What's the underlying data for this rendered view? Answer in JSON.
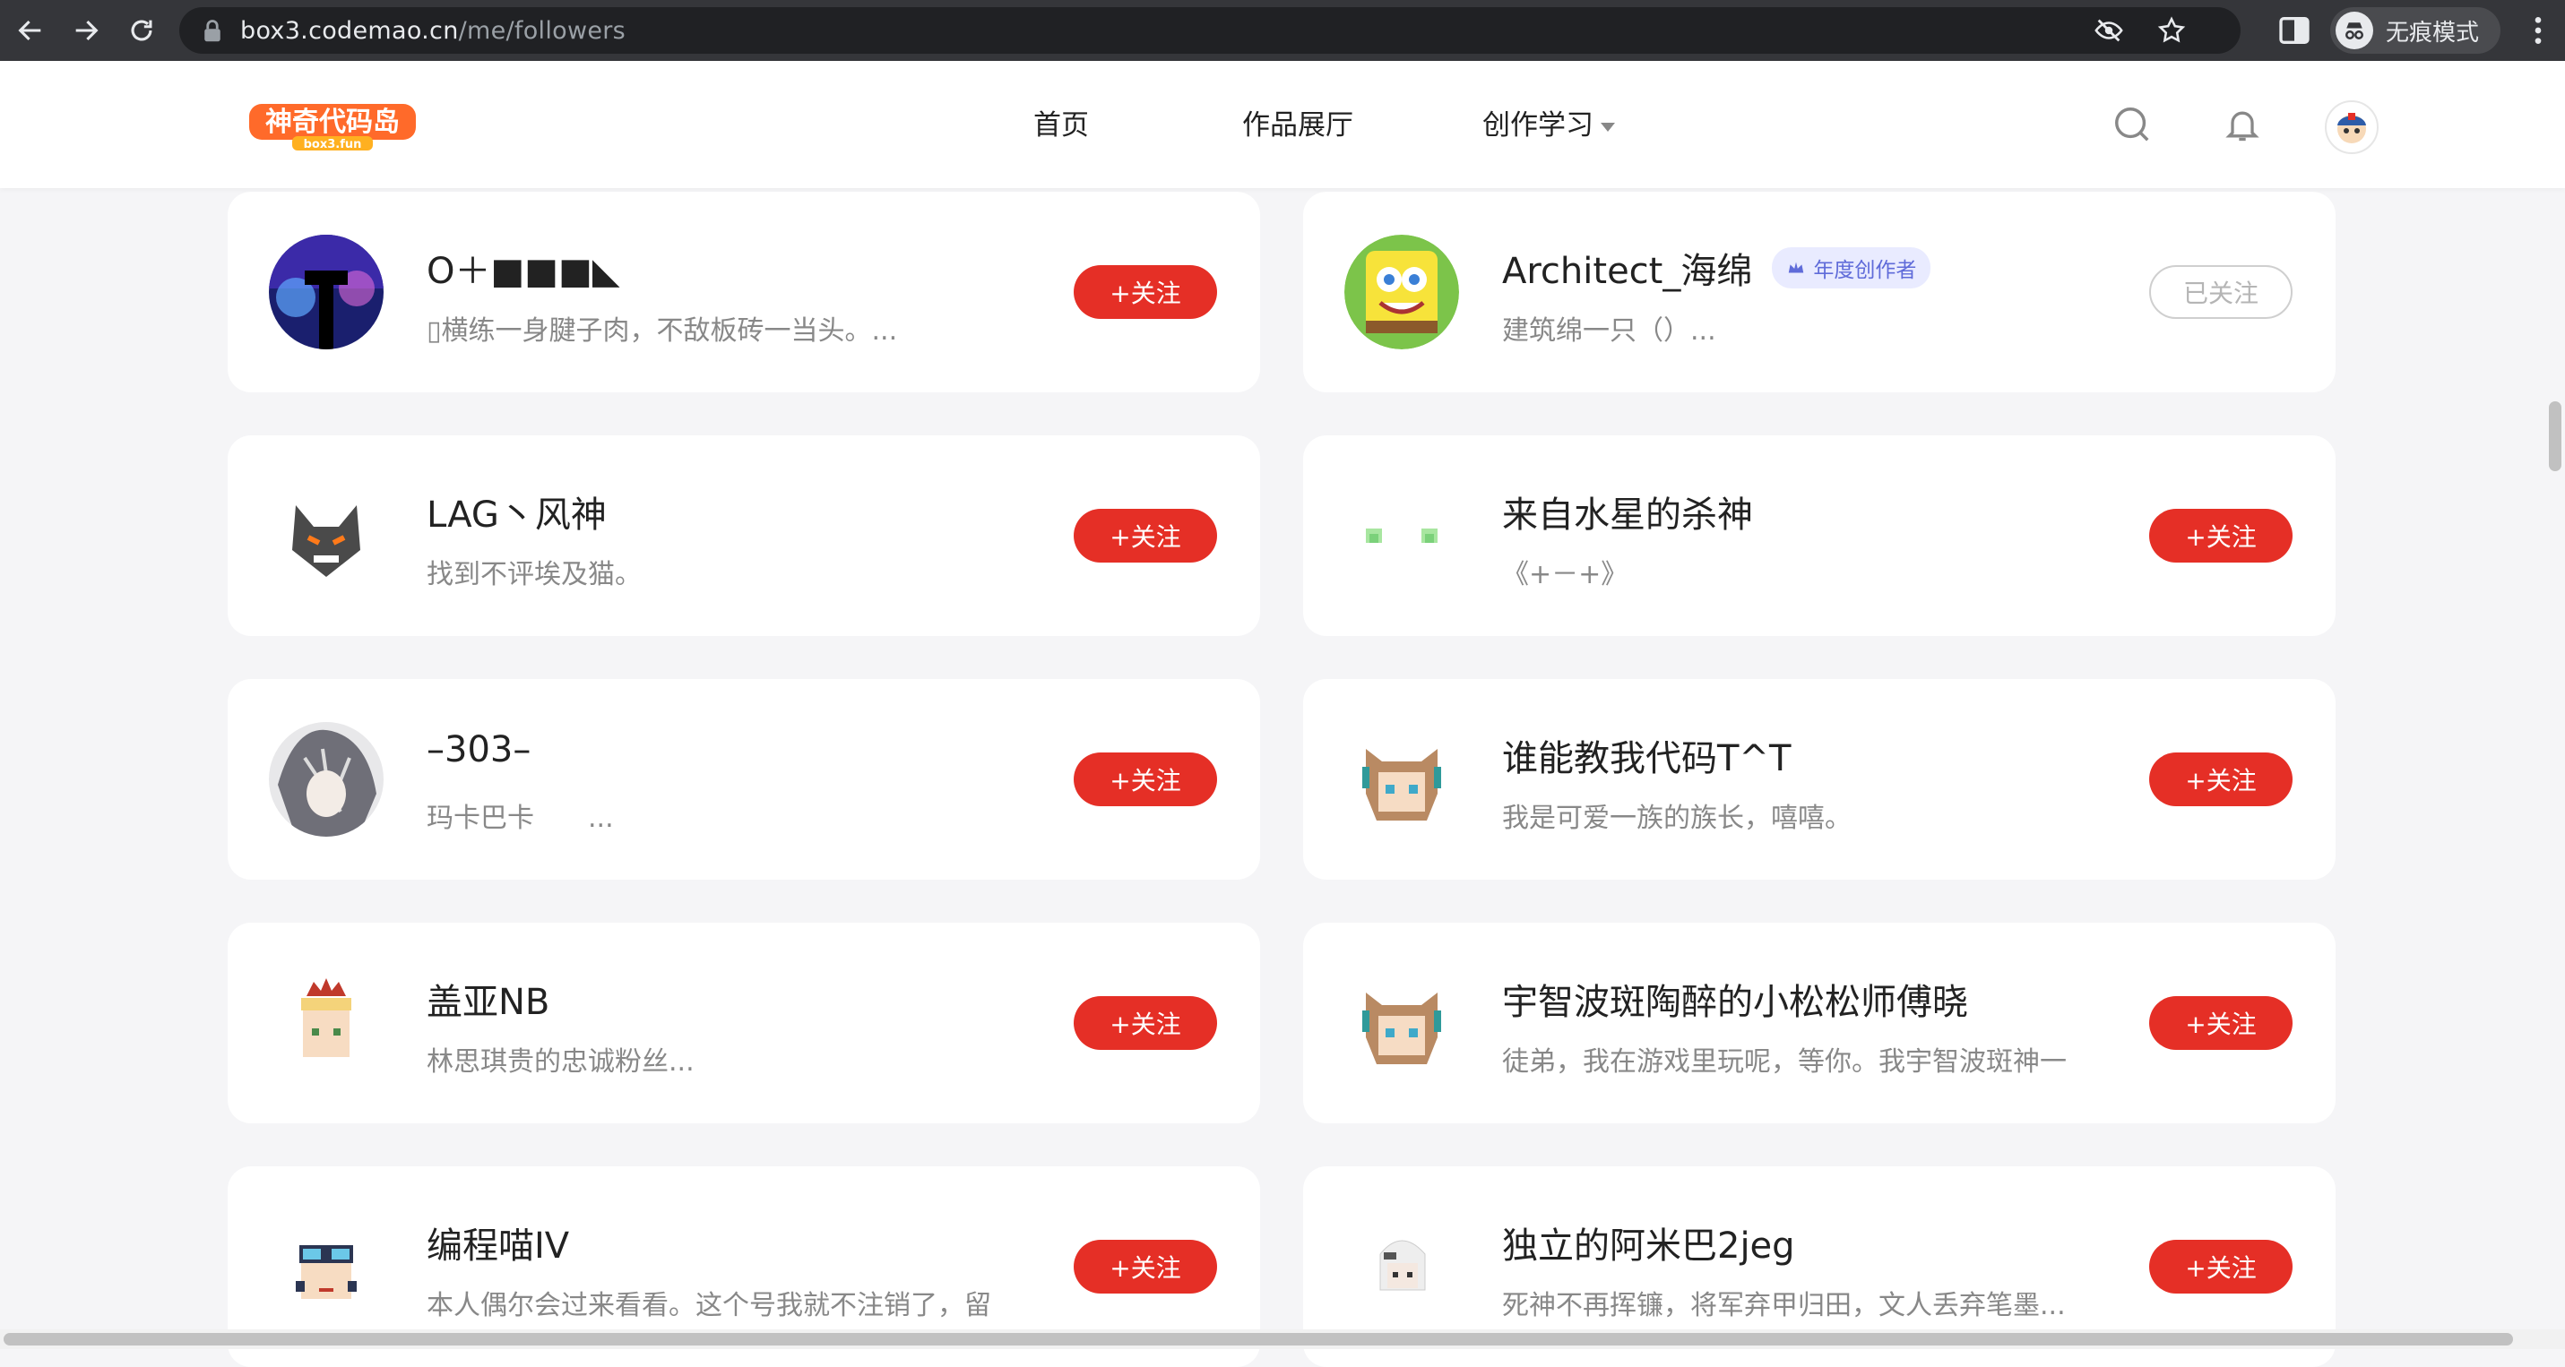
{
  "browser": {
    "url_host": "box3.codemao.cn",
    "url_path": "/me/followers",
    "incognito_label": "无痕模式"
  },
  "header": {
    "logo_text": "神奇代码岛",
    "logo_sub": "box3.fun",
    "nav": [
      {
        "label": "首页"
      },
      {
        "label": "作品展厅"
      },
      {
        "label": "创作学习"
      }
    ]
  },
  "colors": {
    "accent": "#e52f26",
    "badge_bg": "#e9ebff",
    "badge_fg": "#5f6bd9",
    "page_bg": "#f5f5f7"
  },
  "followers": [
    {
      "name": "O＋■■■◣",
      "desc": "▯横练一身腱子肉，不敌板砖一当头。...",
      "button": "+关注",
      "followed": false,
      "badge": ""
    },
    {
      "name": "Architect_海绵",
      "desc": "建筑绵一只（）...",
      "button": "已关注",
      "followed": true,
      "badge": "年度创作者"
    },
    {
      "name": "LAG丶风神",
      "desc": "找到不评埃及猫。",
      "button": "+关注",
      "followed": false,
      "badge": ""
    },
    {
      "name": "来自水星的杀神",
      "desc": "《+－+》",
      "button": "+关注",
      "followed": false,
      "badge": ""
    },
    {
      "name": "–303–",
      "desc": "玛卡巴卡　　...",
      "button": "+关注",
      "followed": false,
      "badge": ""
    },
    {
      "name": "谁能教我代码T^T",
      "desc": "我是可爱一族的族长，嘻嘻。",
      "button": "+关注",
      "followed": false,
      "badge": ""
    },
    {
      "name": "盖亚NB",
      "desc": "林思琪贵的忠诚粉丝...",
      "button": "+关注",
      "followed": false,
      "badge": ""
    },
    {
      "name": "宇智波斑陶醉的小松松师傅晓",
      "desc": "徒弟，我在游戏里玩呢，等你。我宇智波斑神一",
      "button": "+关注",
      "followed": false,
      "badge": ""
    },
    {
      "name": "编程喵IV",
      "desc": "本人偶尔会过来看看。这个号我就不注销了，留",
      "button": "+关注",
      "followed": false,
      "badge": ""
    },
    {
      "name": "独立的阿米巴2jeg",
      "desc": "死神不再挥镰，将军弃甲归田，文人丢弃笔墨...",
      "button": "+关注",
      "followed": false,
      "badge": ""
    }
  ]
}
